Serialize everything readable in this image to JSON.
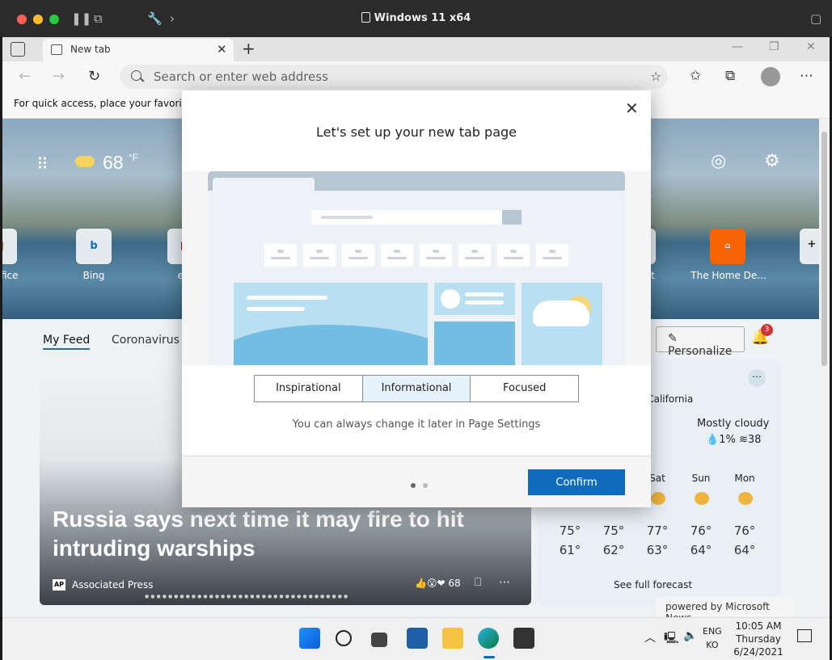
{
  "host": {
    "title": "Windows 11 x64"
  },
  "browser": {
    "tab_title": "New tab",
    "address_placeholder": "Search or enter web address",
    "favorites_hint": "For quick access, place your favorites h"
  },
  "page": {
    "weather_temp": "68",
    "weather_unit": "°F",
    "quicklinks": [
      {
        "label": "fice"
      },
      {
        "label": "Bing"
      },
      {
        "label": "el"
      },
      {
        "label": "rt"
      },
      {
        "label": "The Home De..."
      }
    ],
    "feed_tabs": [
      "My Feed",
      "Coronavirus"
    ],
    "personalize_label": "Personalize",
    "notification_count": "3",
    "headline": "Russia says next time it may fire to hit intruding warships",
    "source": "Associated Press",
    "reaction_count": "68",
    "weather_card": {
      "location": "n, California",
      "condition": "Mostly cloudy",
      "precip": "1%",
      "wind": "38",
      "days": [
        {
          "day": "",
          "hi": "75°",
          "lo": "61°"
        },
        {
          "day": "",
          "hi": "75°",
          "lo": "62°"
        },
        {
          "day": "Sat",
          "hi": "77°",
          "lo": "63°"
        },
        {
          "day": "Sun",
          "hi": "76°",
          "lo": "64°"
        },
        {
          "day": "Mon",
          "hi": "76°",
          "lo": "64°"
        }
      ],
      "forecast_link": "See full forecast"
    },
    "powered_by": "powered by Microsoft News"
  },
  "modal": {
    "title": "Let's set up your new tab page",
    "options": [
      "Inspirational",
      "Informational",
      "Focused"
    ],
    "selected": "Informational",
    "hint": "You can always change it later in Page Settings",
    "confirm_label": "Confirm"
  },
  "taskbar": {
    "lang_top": "ENG",
    "lang_bottom": "KO",
    "time": "10:05 AM",
    "day": "Thursday",
    "date": "6/24/2021"
  },
  "colors": {
    "accent": "#0f6cbd",
    "selected_option_bg": "#e5f1fb"
  }
}
